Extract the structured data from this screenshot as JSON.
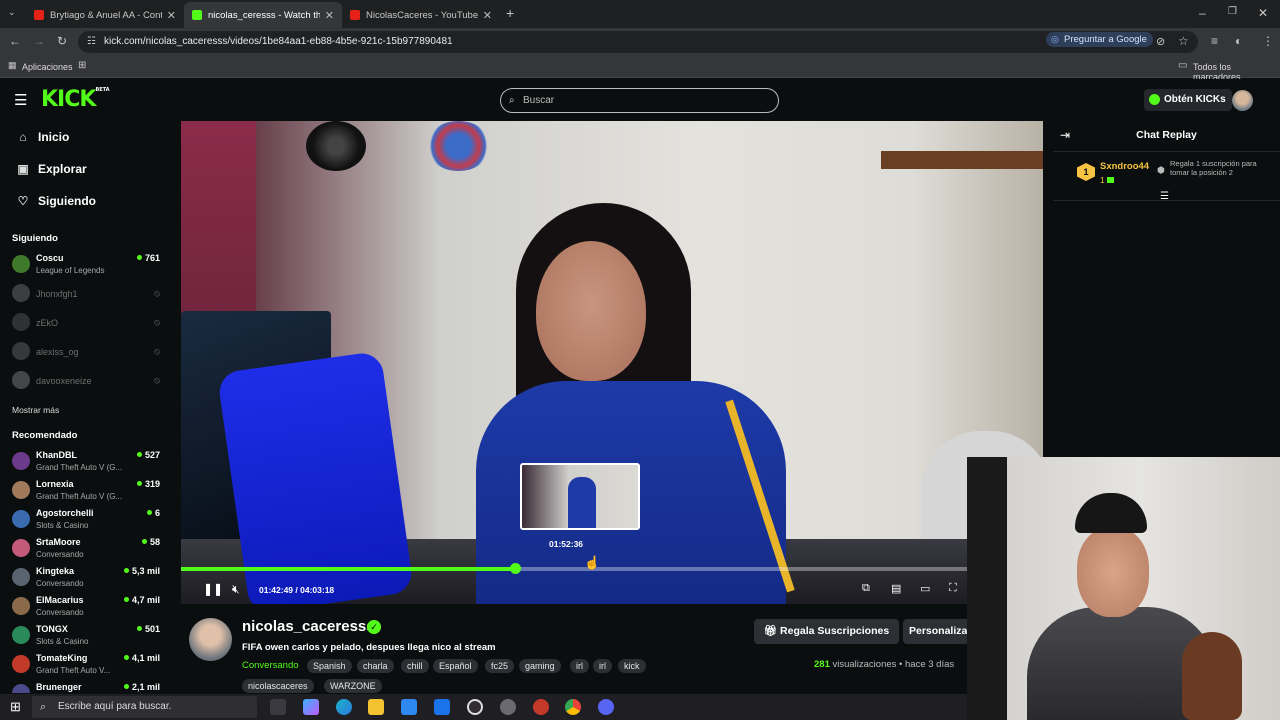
{
  "browser": {
    "tabs": [
      {
        "title": "Brytiago & Anuel AA - Controla",
        "favicon_color": "#e62117"
      },
      {
        "title": "nicolas_ceresss - Watch the V",
        "favicon_color": "#53fc18"
      },
      {
        "title": "NicolasCaceres - YouTube",
        "favicon_color": "#e62117"
      }
    ],
    "url": "kick.com/nicolas_caceresss/videos/1be84aa1-eb88-4b5e-921c-15b977890481",
    "ask_google": "Preguntar a Google",
    "bookmarks_apps": "Aplicaciones",
    "all_bookmarks": "Todos los marcadores"
  },
  "header": {
    "logo": "KICK",
    "logo_badge": "BETA",
    "search_placeholder": "Buscar",
    "get_kicks": "Obtén KICKs"
  },
  "sidebar": {
    "nav": [
      {
        "label": "Inicio",
        "icon": "home-icon"
      },
      {
        "label": "Explorar",
        "icon": "browse-icon"
      },
      {
        "label": "Siguiendo",
        "icon": "heart-icon"
      }
    ],
    "following_title": "Siguiendo",
    "following": [
      {
        "name": "Coscu",
        "game": "League of Legends",
        "viewers": "761",
        "live": true,
        "color": "#3f7a2a"
      },
      {
        "name": "Jhonxfgh1",
        "live": false,
        "color": "#888"
      },
      {
        "name": "zEkO",
        "live": false,
        "color": "#666"
      },
      {
        "name": "alexiss_og",
        "live": false,
        "color": "#777"
      },
      {
        "name": "davooxeneize",
        "live": false,
        "color": "#999"
      }
    ],
    "show_more": "Mostrar más",
    "recommended_title": "Recomendado",
    "recommended": [
      {
        "name": "KhanDBL",
        "game": "Grand Theft Auto V (G...",
        "viewers": "527",
        "color": "#6b3a8a"
      },
      {
        "name": "Lornexia",
        "game": "Grand Theft Auto V (G...",
        "viewers": "319",
        "color": "#a07a5a"
      },
      {
        "name": "Agostorchelli",
        "game": "Slots & Casino",
        "viewers": "6",
        "color": "#3a6ab0"
      },
      {
        "name": "SrtaMoore",
        "game": "Conversando",
        "viewers": "58",
        "color": "#c45a7a"
      },
      {
        "name": "Kingteka",
        "game": "Conversando",
        "viewers": "5,3 mil",
        "color": "#5a6470"
      },
      {
        "name": "ElMacarius",
        "game": "Conversando",
        "viewers": "4,7 mil",
        "color": "#8a6a4a"
      },
      {
        "name": "TONGX",
        "game": "Slots & Casino",
        "viewers": "501",
        "color": "#2a8a5a"
      },
      {
        "name": "TomateKing",
        "game": "Grand Theft Auto V...",
        "viewers": "4,1 mil",
        "color": "#c43a2a"
      },
      {
        "name": "Brunenger",
        "game": "",
        "viewers": "2,1 mil",
        "color": "#4a4a8a"
      }
    ]
  },
  "player": {
    "preview_time": "01:52:36",
    "current_time": "01:42:49",
    "duration": "04:03:18",
    "progress_fraction": 0.4225
  },
  "stream": {
    "streamer": "nicolas_caceresss",
    "title": "FIFA owen carlos y pelado, despues llega nico al stream",
    "category": "Conversando",
    "tags": [
      "Spanish",
      "charla",
      "chill",
      "Español",
      "fc25",
      "gaming",
      "irl",
      "irl",
      "kick",
      "nicolascaceres",
      "WARZONE"
    ],
    "gift_button": "Regala Suscripciones",
    "customize_button": "Personaliza",
    "views_count": "281",
    "views_label": "visualizaciones",
    "time_ago": "hace 3 días"
  },
  "chat": {
    "title": "Chat Replay",
    "top_gifter": {
      "rank": "1",
      "name": "Sxndroo44",
      "count": "1"
    },
    "gift_text": "Regala 1 suscripción para tomar la posición 2"
  },
  "taskbar": {
    "search_placeholder": "Escribe aquí para buscar."
  }
}
